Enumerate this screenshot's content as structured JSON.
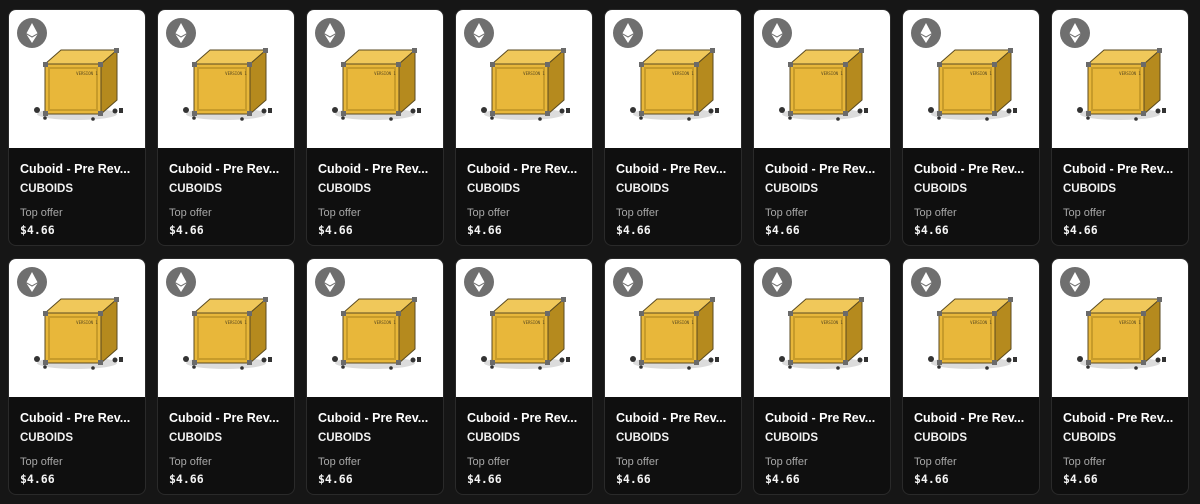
{
  "items": [
    {
      "name": "Cuboid - Pre Rev...",
      "collection": "CUBOIDS",
      "offer_label": "Top offer",
      "price": "$4.66",
      "chain_icon": "ethereum-icon",
      "crate_text": "VERSION 1"
    },
    {
      "name": "Cuboid - Pre Rev...",
      "collection": "CUBOIDS",
      "offer_label": "Top offer",
      "price": "$4.66",
      "chain_icon": "ethereum-icon",
      "crate_text": "VERSION 1"
    },
    {
      "name": "Cuboid - Pre Rev...",
      "collection": "CUBOIDS",
      "offer_label": "Top offer",
      "price": "$4.66",
      "chain_icon": "ethereum-icon",
      "crate_text": "VERSION 1"
    },
    {
      "name": "Cuboid - Pre Rev...",
      "collection": "CUBOIDS",
      "offer_label": "Top offer",
      "price": "$4.66",
      "chain_icon": "ethereum-icon",
      "crate_text": "VERSION 1"
    },
    {
      "name": "Cuboid - Pre Rev...",
      "collection": "CUBOIDS",
      "offer_label": "Top offer",
      "price": "$4.66",
      "chain_icon": "ethereum-icon",
      "crate_text": "VERSION 1"
    },
    {
      "name": "Cuboid - Pre Rev...",
      "collection": "CUBOIDS",
      "offer_label": "Top offer",
      "price": "$4.66",
      "chain_icon": "ethereum-icon",
      "crate_text": "VERSION 1"
    },
    {
      "name": "Cuboid - Pre Rev...",
      "collection": "CUBOIDS",
      "offer_label": "Top offer",
      "price": "$4.66",
      "chain_icon": "ethereum-icon",
      "crate_text": "VERSION 1"
    },
    {
      "name": "Cuboid - Pre Rev...",
      "collection": "CUBOIDS",
      "offer_label": "Top offer",
      "price": "$4.66",
      "chain_icon": "ethereum-icon",
      "crate_text": "VERSION 1"
    },
    {
      "name": "Cuboid - Pre Rev...",
      "collection": "CUBOIDS",
      "offer_label": "Top offer",
      "price": "$4.66",
      "chain_icon": "ethereum-icon",
      "crate_text": "VERSION 1"
    },
    {
      "name": "Cuboid - Pre Rev...",
      "collection": "CUBOIDS",
      "offer_label": "Top offer",
      "price": "$4.66",
      "chain_icon": "ethereum-icon",
      "crate_text": "VERSION 1"
    },
    {
      "name": "Cuboid - Pre Rev...",
      "collection": "CUBOIDS",
      "offer_label": "Top offer",
      "price": "$4.66",
      "chain_icon": "ethereum-icon",
      "crate_text": "VERSION 1"
    },
    {
      "name": "Cuboid - Pre Rev...",
      "collection": "CUBOIDS",
      "offer_label": "Top offer",
      "price": "$4.66",
      "chain_icon": "ethereum-icon",
      "crate_text": "VERSION 1"
    },
    {
      "name": "Cuboid - Pre Rev...",
      "collection": "CUBOIDS",
      "offer_label": "Top offer",
      "price": "$4.66",
      "chain_icon": "ethereum-icon",
      "crate_text": "VERSION 1"
    },
    {
      "name": "Cuboid - Pre Rev...",
      "collection": "CUBOIDS",
      "offer_label": "Top offer",
      "price": "$4.66",
      "chain_icon": "ethereum-icon",
      "crate_text": "VERSION 1"
    },
    {
      "name": "Cuboid - Pre Rev...",
      "collection": "CUBOIDS",
      "offer_label": "Top offer",
      "price": "$4.66",
      "chain_icon": "ethereum-icon",
      "crate_text": "VERSION 1"
    },
    {
      "name": "Cuboid - Pre Rev...",
      "collection": "CUBOIDS",
      "offer_label": "Top offer",
      "price": "$4.66",
      "chain_icon": "ethereum-icon",
      "crate_text": "VERSION 1"
    }
  ],
  "colors": {
    "page_background": "#161616",
    "card_background": "#0f0f0f",
    "media_background": "#ffffff",
    "chain_badge": "#6f6f6f",
    "crate_gold": "#e8b73a",
    "crate_dark": "#b58a1e"
  }
}
